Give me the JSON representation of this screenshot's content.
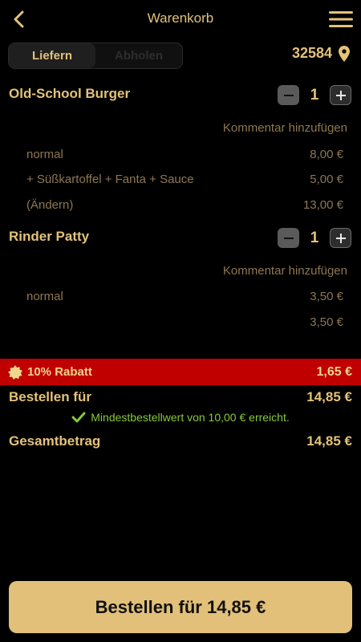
{
  "header": {
    "title": "Warenkorb"
  },
  "delivery_toggle": {
    "options": [
      "Liefern",
      "Abholen"
    ],
    "selected": "Liefern"
  },
  "location": {
    "zip": "32584"
  },
  "cart": {
    "items": [
      {
        "name": "Old-School Burger",
        "quantity": "1",
        "comment_label": "Kommentar hinzufügen",
        "lines": [
          {
            "label": "normal",
            "price": "8,00 €"
          },
          {
            "label": "+ Süßkartoffel + Fanta + Sauce",
            "price": "5,00 €"
          },
          {
            "label": "(Ändern)",
            "price": "13,00 €"
          }
        ]
      },
      {
        "name": "Rinder Patty",
        "quantity": "1",
        "comment_label": "Kommentar hinzufügen",
        "lines": [
          {
            "label": "normal",
            "price": "3,50 €"
          },
          {
            "label": "",
            "price": "3,50 €"
          }
        ]
      }
    ]
  },
  "discount": {
    "label": "10% Rabatt",
    "value": "1,65 €"
  },
  "summary": {
    "order_for_label": "Bestellen für",
    "order_for_value": "14,85 €",
    "min_order_text": "Mindestbestellwert von 10,00 € erreicht.",
    "total_label": "Gesamtbetrag",
    "total_value": "14,85 €"
  },
  "order_button": {
    "label": "Bestellen für 14,85 €"
  },
  "colors": {
    "accent": "#e3c27a",
    "discount_bg": "#c00000",
    "success": "#86c93b",
    "button_bg": "#e2c07a"
  }
}
